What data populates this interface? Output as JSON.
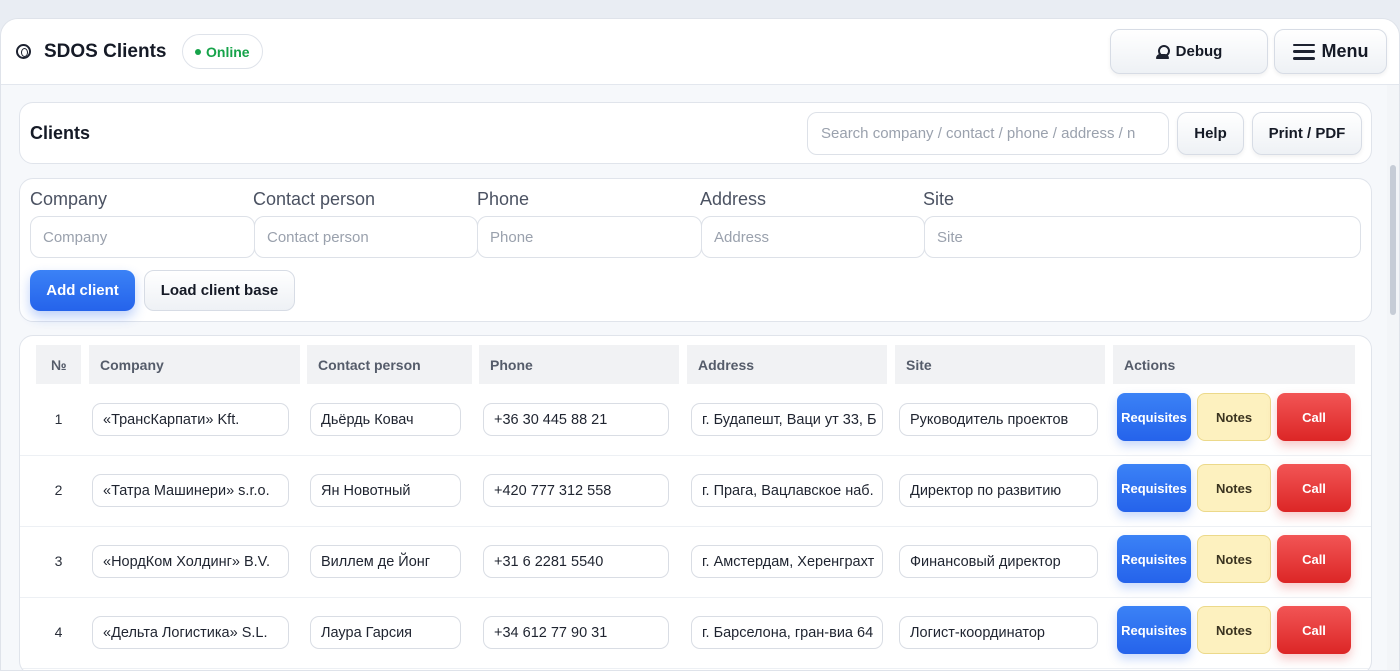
{
  "app": {
    "title": "SDOS Clients",
    "status": "Online",
    "debug_label": "Debug",
    "menu_label": "Menu"
  },
  "header": {
    "title": "Clients",
    "search_placeholder": "Search company / contact / phone / address / n",
    "help_label": "Help",
    "print_label": "Print / PDF"
  },
  "form": {
    "fields": [
      {
        "label": "Company",
        "placeholder": "Company"
      },
      {
        "label": "Contact person",
        "placeholder": "Contact person"
      },
      {
        "label": "Phone",
        "placeholder": "Phone"
      },
      {
        "label": "Address",
        "placeholder": "Address"
      },
      {
        "label": "Site",
        "placeholder": "Site"
      }
    ],
    "add_label": "Add client",
    "load_label": "Load client base"
  },
  "table": {
    "columns": [
      "№",
      "Company",
      "Contact person",
      "Phone",
      "Address",
      "Site",
      "Actions"
    ],
    "actions": {
      "requisites": "Requisites",
      "notes": "Notes",
      "call": "Call"
    },
    "rows": [
      {
        "num": "1",
        "company": "«ТрансКарпати» Kft.",
        "contact": "Дьёрдь Ковач",
        "phone": "+36 30 445 88 21",
        "address": "г. Будапешт, Ваци ут 33, Б",
        "site": "Руководитель проектов"
      },
      {
        "num": "2",
        "company": "«Татра Машинери» s.r.o.",
        "contact": "Ян Новотный",
        "phone": "+420 777 312 558",
        "address": "г. Прага, Вацлавское наб.",
        "site": "Директор по развитию"
      },
      {
        "num": "3",
        "company": "«НордКом Холдинг» B.V.",
        "contact": "Виллем де Йонг",
        "phone": "+31 6 2281 5540",
        "address": "г. Амстердам, Херенграхт",
        "site": "Финансовый директор"
      },
      {
        "num": "4",
        "company": "«Дельта Логистика» S.L.",
        "contact": "Лаура Гарсия",
        "phone": "+34 612 77 90 31",
        "address": "г. Барселона, гран-виа 64",
        "site": "Логист-координатор"
      }
    ]
  },
  "colors": {
    "accent_blue": "#2563eb",
    "notes_yellow": "#fdf1bf",
    "call_red": "#dc2626",
    "online_green": "#16a34a"
  }
}
